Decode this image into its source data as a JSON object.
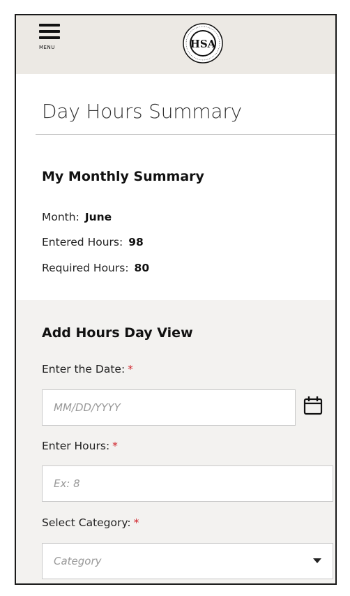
{
  "header": {
    "menu_label": "MENU",
    "logo_text": "HSA"
  },
  "page": {
    "title": "Day Hours Summary"
  },
  "summary": {
    "title": "My Monthly Summary",
    "month_label": "Month:",
    "month_value": "June",
    "entered_label": "Entered Hours:",
    "entered_value": "98",
    "required_label": "Required Hours:",
    "required_value": "80"
  },
  "form": {
    "title": "Add Hours Day View",
    "date_label": "Enter the Date:",
    "date_placeholder": "MM/DD/YYYY",
    "hours_label": "Enter Hours:",
    "hours_placeholder": "Ex: 8",
    "category_label": "Select Category:",
    "category_placeholder": "Category",
    "required_marker": "*"
  }
}
